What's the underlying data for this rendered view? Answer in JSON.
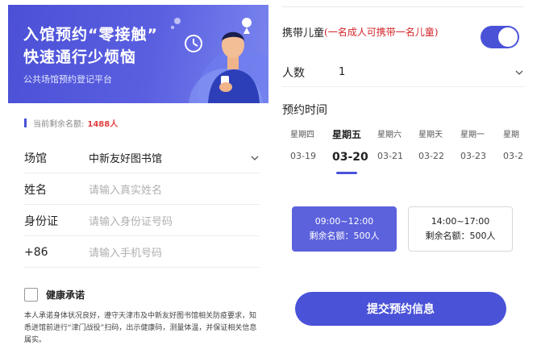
{
  "banner": {
    "title_line1": "入馆预约“零接触”",
    "title_line2": "快速通行少烦恼",
    "subtitle": "公共场馆预约登记平台"
  },
  "remain": {
    "label": "当前剩余名额:",
    "value": "1488人"
  },
  "form": {
    "venue": {
      "label": "场馆",
      "value": "中新友好图书馆"
    },
    "name": {
      "label": "姓名",
      "placeholder": "请输入真实姓名"
    },
    "id_card": {
      "label": "身份证",
      "placeholder": "请输入身份证号码"
    },
    "phone": {
      "label": "+86",
      "placeholder": "请输入手机号码"
    }
  },
  "health": {
    "title": "健康承诺",
    "pledge_text": "本人承诺身体状况良好，遵守天津市及中新友好图书馆相关防疫要求，知悉进馆前进行“津门战役”扫码，出示健康码，测量体温，并保证相关信息属实。"
  },
  "child": {
    "label": "携带儿童",
    "note": "(一名成人可携带一名儿童)",
    "toggle_on": true
  },
  "people": {
    "label": "人数",
    "value": "1"
  },
  "booking": {
    "time_header": "预约时间",
    "days": [
      {
        "weekday": "星期四",
        "date": "03-19",
        "selected": false
      },
      {
        "weekday": "星期五",
        "date": "03-20",
        "selected": true
      },
      {
        "weekday": "星期六",
        "date": "03-21",
        "selected": false
      },
      {
        "weekday": "星期天",
        "date": "03-22",
        "selected": false
      },
      {
        "weekday": "星期一",
        "date": "03-23",
        "selected": false
      },
      {
        "weekday": "星期",
        "date": "03-2",
        "selected": false
      }
    ],
    "slots": [
      {
        "time": "09:00~12:00",
        "remaining": "剩余名额：500人",
        "selected": true
      },
      {
        "time": "14:00~17:00",
        "remaining": "剩余名额：500人",
        "selected": false
      }
    ],
    "submit_label": "提交预约信息"
  },
  "colors": {
    "accent": "#4a52d8",
    "highlight_red": "#e24040",
    "note_red": "#d3262b"
  },
  "icons": {
    "dropdown": "chevron-down-icon",
    "banner_art": "person-with-phone-illustration"
  }
}
